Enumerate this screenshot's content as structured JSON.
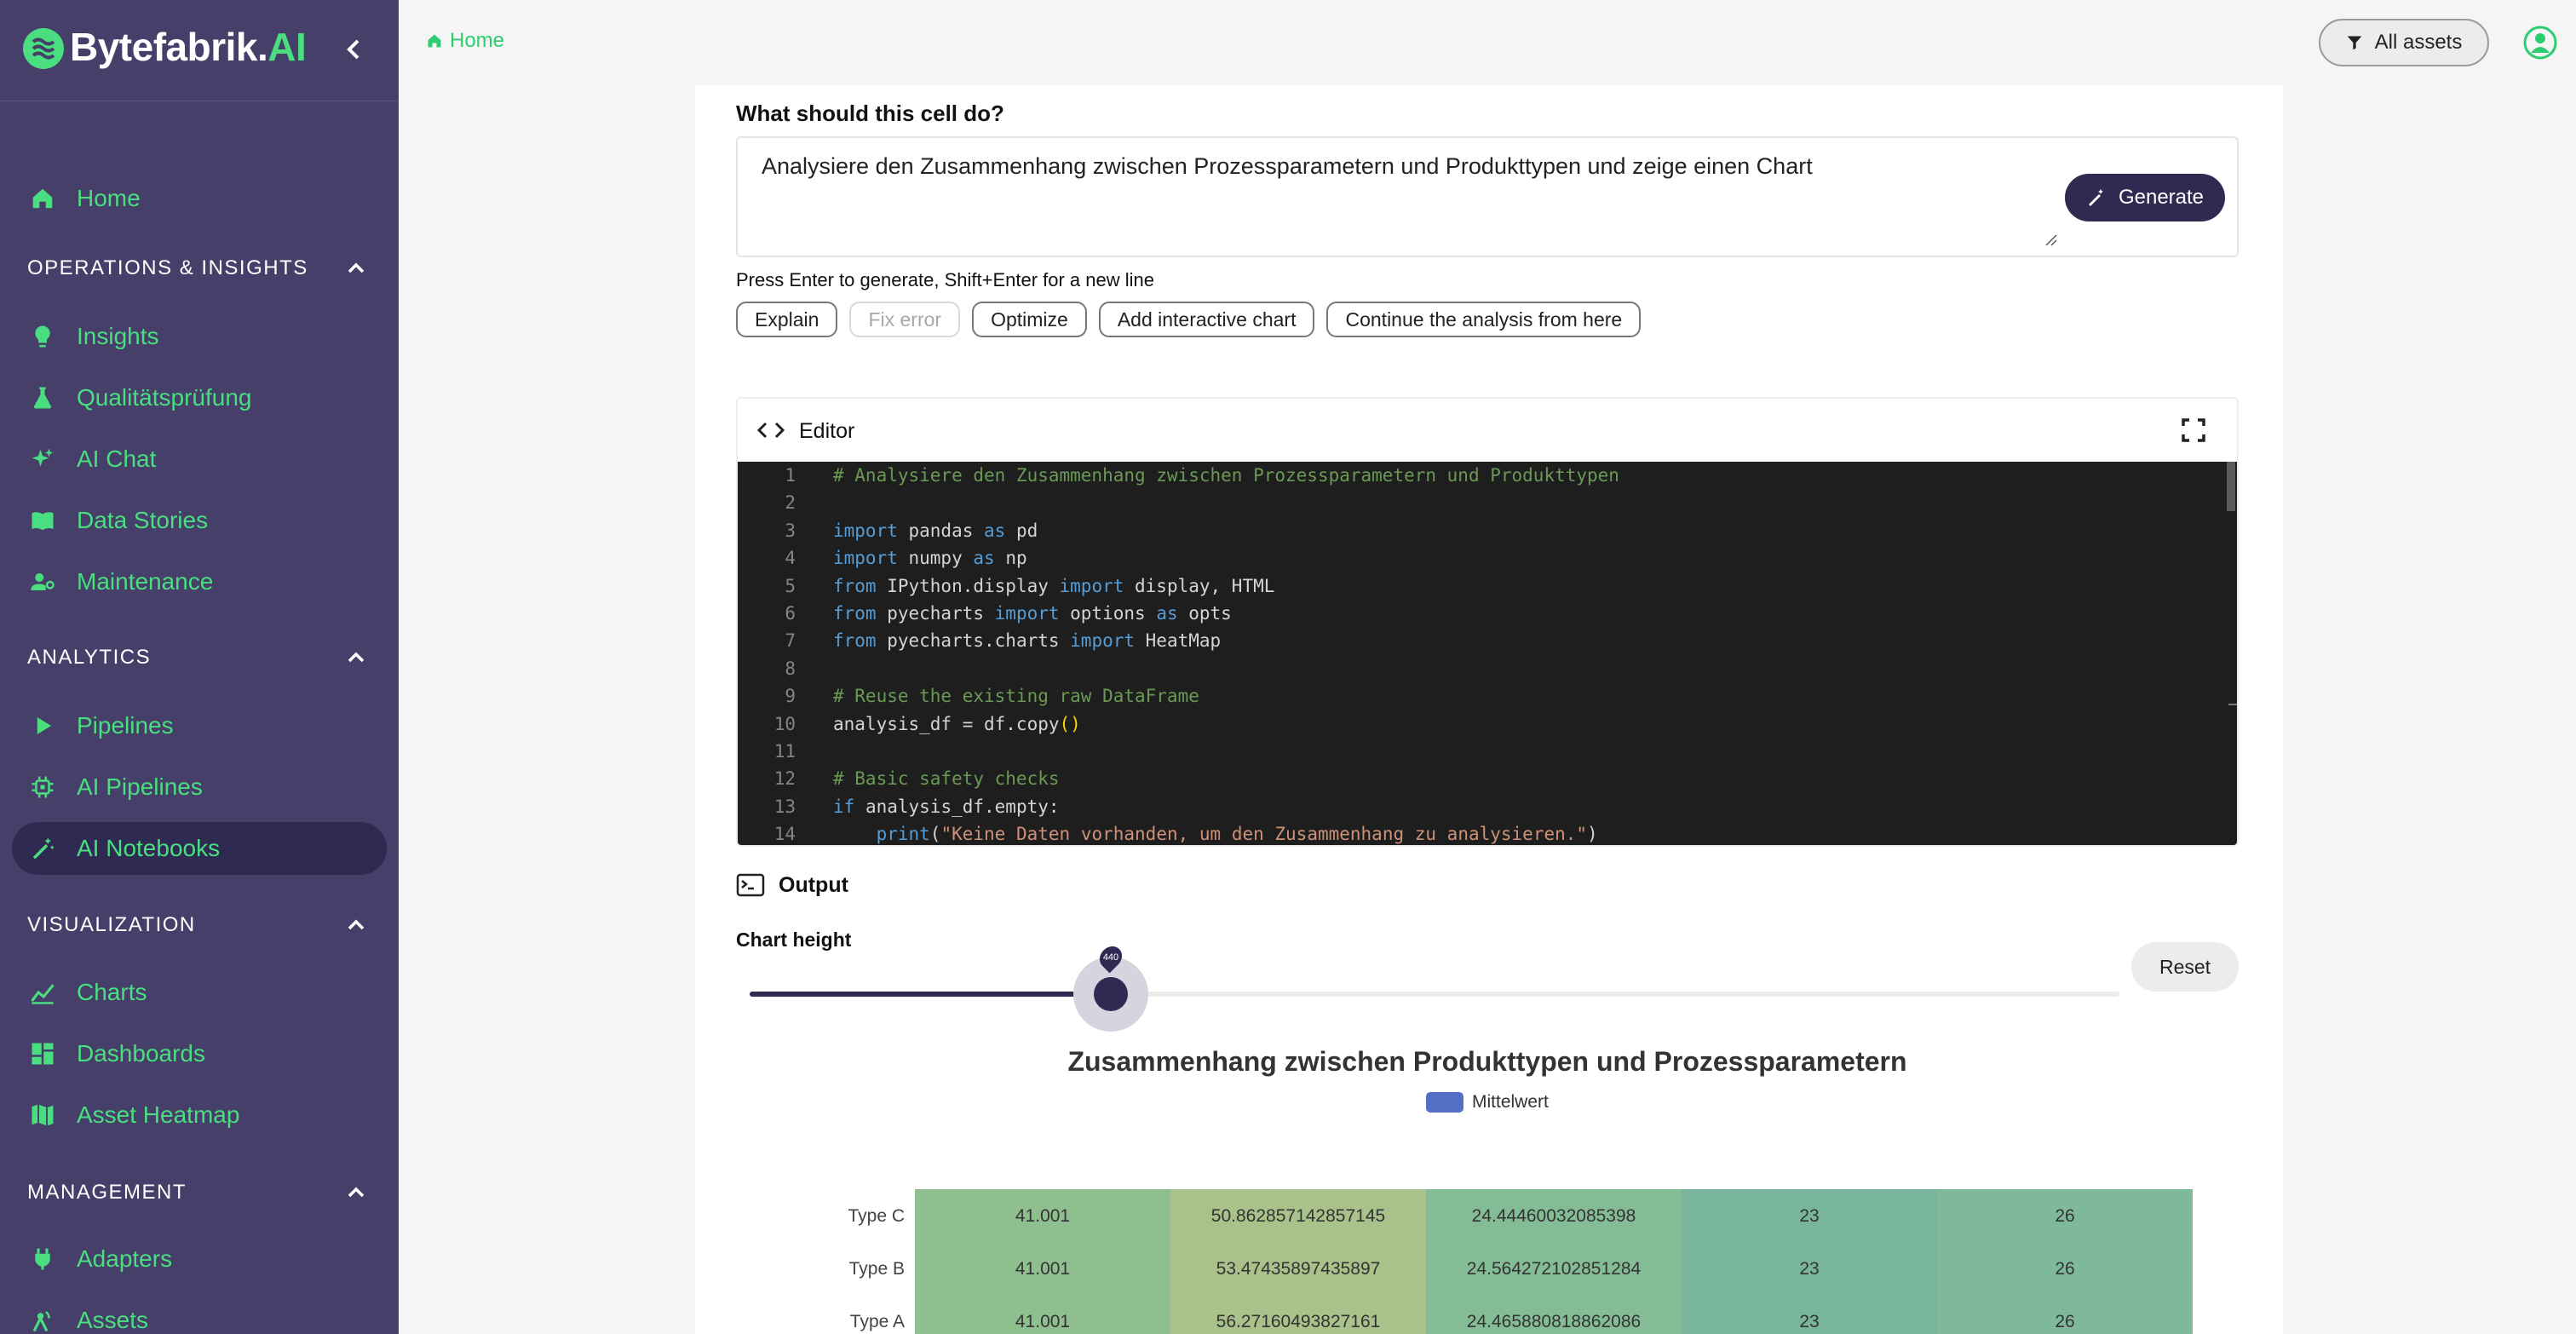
{
  "app": {
    "logo_text": "Bytefabrik.",
    "logo_ai": "AI"
  },
  "sidebar": {
    "home": "Home",
    "sections": [
      {
        "title": "OPERATIONS & INSIGHTS",
        "items": [
          "Insights",
          "Qualitätsprüfung",
          "AI Chat",
          "Data Stories",
          "Maintenance"
        ]
      },
      {
        "title": "ANALYTICS",
        "items": [
          "Pipelines",
          "AI Pipelines",
          "AI Notebooks"
        ]
      },
      {
        "title": "VISUALIZATION",
        "items": [
          "Charts",
          "Dashboards",
          "Asset Heatmap"
        ]
      },
      {
        "title": "MANAGEMENT",
        "items": [
          "Adapters",
          "Assets"
        ]
      }
    ],
    "active_item": "AI Notebooks"
  },
  "topbar": {
    "breadcrumb": "Home",
    "filter_button": "All assets"
  },
  "prompt": {
    "heading": "What should this cell do?",
    "value": "Analysiere den Zusammenhang zwischen Prozessparametern und Produkttypen und zeige einen Chart",
    "generate_label": "Generate",
    "hint": "Press Enter to generate, Shift+Enter for a new line",
    "actions": [
      {
        "label": "Explain",
        "enabled": true
      },
      {
        "label": "Fix error",
        "enabled": false
      },
      {
        "label": "Optimize",
        "enabled": true
      },
      {
        "label": "Add interactive chart",
        "enabled": true
      },
      {
        "label": "Continue the analysis from here",
        "enabled": true
      }
    ]
  },
  "editor": {
    "title": "Editor",
    "lines": [
      {
        "n": "1",
        "text": "# Analysiere den Zusammenhang zwischen Prozessparametern und Produkttypen"
      },
      {
        "n": "2",
        "text": ""
      },
      {
        "n": "3",
        "text": "import pandas as pd"
      },
      {
        "n": "4",
        "text": "import numpy as np"
      },
      {
        "n": "5",
        "text": "from IPython.display import display, HTML"
      },
      {
        "n": "6",
        "text": "from pyecharts import options as opts"
      },
      {
        "n": "7",
        "text": "from pyecharts.charts import HeatMap"
      },
      {
        "n": "8",
        "text": ""
      },
      {
        "n": "9",
        "text": "# Reuse the existing raw DataFrame"
      },
      {
        "n": "10",
        "text": "analysis_df = df.copy()"
      },
      {
        "n": "11",
        "text": ""
      },
      {
        "n": "12",
        "text": "# Basic safety checks"
      },
      {
        "n": "13",
        "text": "if analysis_df.empty:"
      },
      {
        "n": "14",
        "text": "    print(\"Keine Daten vorhanden, um den Zusammenhang zu analysieren.\")"
      }
    ]
  },
  "output": {
    "title": "Output",
    "chart_height_label": "Chart height",
    "chart_height_value": "440",
    "chart_height_fraction": 0.264,
    "reset_label": "Reset"
  },
  "chart_data": {
    "type": "heatmap",
    "title": "Zusammenhang zwischen Produkttypen und Prozessparametern",
    "legend": [
      "Mittelwert"
    ],
    "rows": [
      "Type C",
      "Type B",
      "Type A"
    ],
    "cells": [
      [
        "41.001",
        "50.862857142857145",
        "24.44460032085398",
        "23",
        "26"
      ],
      [
        "41.001",
        "53.47435897435897",
        "24.564272102851284",
        "23",
        "26"
      ],
      [
        "41.001",
        "56.27160493827161",
        "24.465880818862086",
        "23",
        "26"
      ]
    ],
    "colors": {
      "col0": "#8fbf8f",
      "col1": "#a9c18a",
      "col2": "#84bd95",
      "col3": "#79b59c",
      "col4": "#7fb99b"
    }
  }
}
